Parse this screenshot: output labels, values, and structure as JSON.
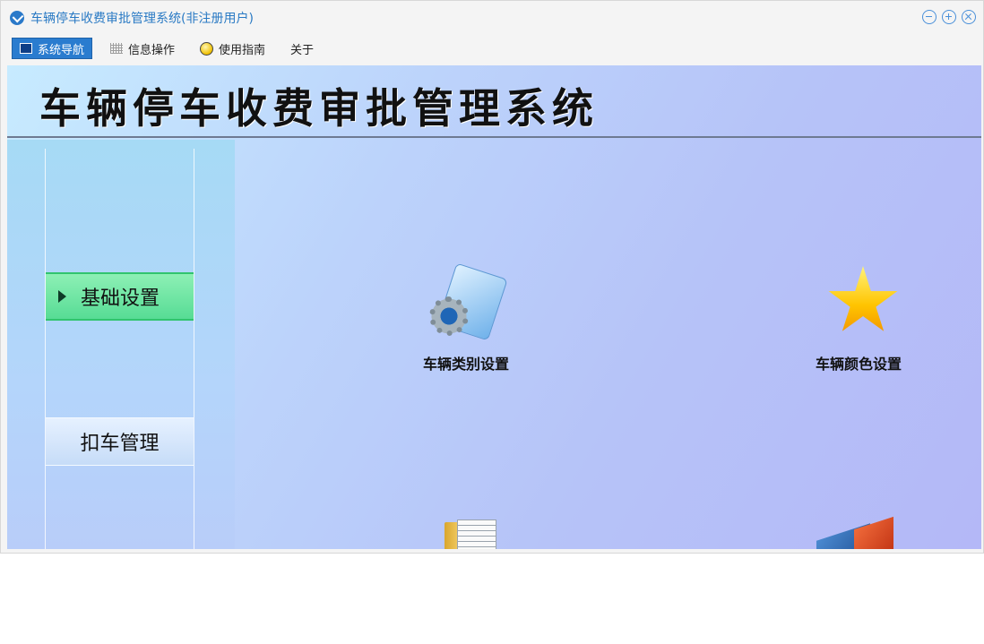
{
  "window": {
    "title": "车辆停车收费审批管理系统(非注册用户)"
  },
  "menu": {
    "items": [
      {
        "label": "系统导航",
        "icon": "nav-icon",
        "active": true
      },
      {
        "label": "信息操作",
        "icon": "grid-icon",
        "active": false
      },
      {
        "label": "使用指南",
        "icon": "guide-icon",
        "active": false
      },
      {
        "label": "关于",
        "icon": "",
        "active": false
      }
    ]
  },
  "banner": {
    "title": "车辆停车收费审批管理系统"
  },
  "sidebar": {
    "items": [
      {
        "label": "基础设置",
        "active": true
      },
      {
        "label": "扣车管理",
        "active": false
      }
    ]
  },
  "tiles": [
    {
      "label": "车辆类别设置",
      "icon": "gear-folder-icon"
    },
    {
      "label": "车辆颜色设置",
      "icon": "star-icon"
    }
  ],
  "colors": {
    "title_text": "#2a7ac4",
    "active_menu": "#2a7ccf",
    "active_sidebar": "#57dc95"
  }
}
